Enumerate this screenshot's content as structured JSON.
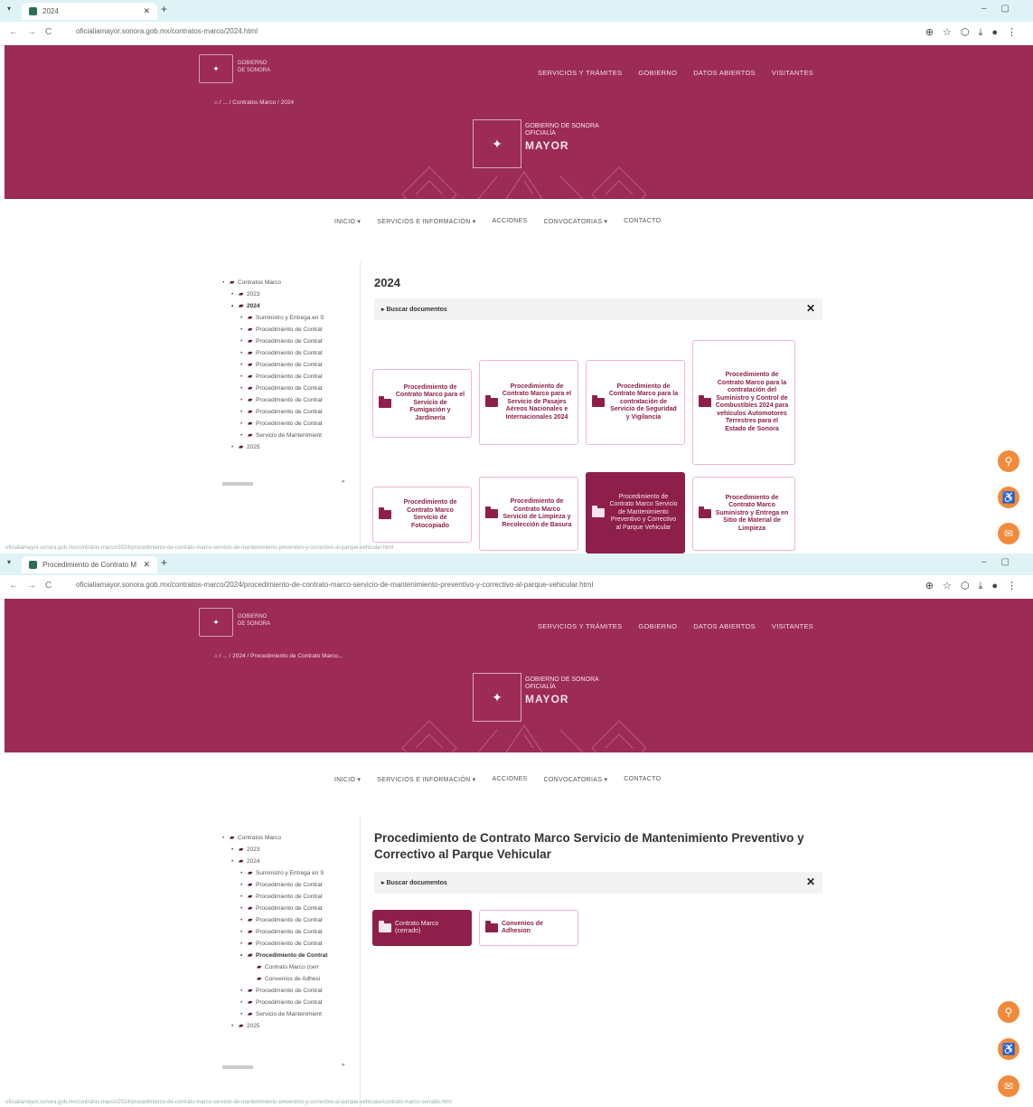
{
  "shot1": {
    "tab_title": "2024",
    "url": "oficialiamayor.sonora.gob.mx/contratos-marco/2024.html",
    "breadcrumb": "⌂ / ... / Contratos Marco / 2024",
    "title": "2024",
    "status_url": "oficialiamayor.sonora.gob.mx/contratos-marco/2024/procedimiento-de-contrato-marco-servicio-de-mantenimiento-preventivo-y-correctivo-al-parque-vehicular.html",
    "cards": [
      "Procedimiento de Contrato Marco para el Servicio de Fumigación y Jardinería",
      "Procedimiento de Contrato Marco para el Servicio de Pasajes Aéreos Nacionales e Internacionales 2024",
      "Procedimiento de Contrato Marco para la contratación de Servicio de Seguridad y Vigilancia",
      "Procedimiento de Contrato Marco para la contratación del Suministro y Control de Combustibles 2024 para vehículos Automotores Terrestres para el Estado de Sonora",
      "Procedimiento de Contrato Marco Servicio de Fotocopiado",
      "Procedimiento de Contrato Marco Servicio de Limpieza y Recolección de Basura",
      "Procedimiento de Contrato Marco Servicio de Mantenimiento Preventivo y Correctivo al Parque Vehicular",
      "Procedimiento de Contrato Marco Suministro y Entrega en Sitio de Material de Limpieza"
    ],
    "tree": [
      {
        "label": "Contratos Marco",
        "level": 0
      },
      {
        "label": "2023",
        "level": 1
      },
      {
        "label": "2024",
        "level": 1,
        "bold": true
      },
      {
        "label": "Suministro y Entrega en S",
        "level": 2
      },
      {
        "label": "Procedimiento de Contrat",
        "level": 2
      },
      {
        "label": "Procedimiento de Contrat",
        "level": 2
      },
      {
        "label": "Procedimiento de Contrat",
        "level": 2
      },
      {
        "label": "Procedimiento de Contrat",
        "level": 2
      },
      {
        "label": "Procedimiento de Contrat",
        "level": 2
      },
      {
        "label": "Procedimiento de Contrat",
        "level": 2
      },
      {
        "label": "Procedimiento de Contrat",
        "level": 2
      },
      {
        "label": "Procedimiento de Contrat",
        "level": 2
      },
      {
        "label": "Procedimiento de Contrat",
        "level": 2
      },
      {
        "label": "Servicio de Mantenimient",
        "level": 2
      },
      {
        "label": "2025",
        "level": 1
      }
    ]
  },
  "shot2": {
    "tab_title": "Procedimiento de Contrato M",
    "url": "oficialiamayor.sonora.gob.mx/contratos-marco/2024/procedimiento-de-contrato-marco-servicio-de-mantenimiento-preventivo-y-correctivo-al-parque-vehicular.html",
    "breadcrumb": "⌂ / ... / 2024 / Procedimiento de Contrato Marco...",
    "title": "Procedimiento de Contrato Marco Servicio de Mantenimiento Preventivo y Correctivo al Parque Vehicular",
    "cards": [
      "Contrato Marco (cerrado)",
      "Convenios de Adhesion"
    ],
    "status_url": "oficialiamayor.sonora.gob.mx/contratos-marco/2024/procedimiento-de-contrato-marco-servicio-de-mantenimiento-preventivo-y-correctivo-al-parque-vehicular/contrato-marco-cerrado.html",
    "tree": [
      {
        "label": "Contratos Marco",
        "level": 0
      },
      {
        "label": "2023",
        "level": 1
      },
      {
        "label": "2024",
        "level": 1
      },
      {
        "label": "Suministro y Entrega en S",
        "level": 2
      },
      {
        "label": "Procedimiento de Contrat",
        "level": 2
      },
      {
        "label": "Procedimiento de Contrat",
        "level": 2
      },
      {
        "label": "Procedimiento de Contrat",
        "level": 2
      },
      {
        "label": "Procedimiento de Contrat",
        "level": 2
      },
      {
        "label": "Procedimiento de Contrat",
        "level": 2
      },
      {
        "label": "Procedimiento de Contrat",
        "level": 2
      },
      {
        "label": "Procedimiento de Contrat",
        "level": 2,
        "bold": true
      },
      {
        "label": "Contrato Marco (cerr",
        "level": 3
      },
      {
        "label": "Convenios de Adhesi",
        "level": 3
      },
      {
        "label": "Procedimiento de Contrat",
        "level": 2
      },
      {
        "label": "Procedimiento de Contrat",
        "level": 2
      },
      {
        "label": "Servicio de Mantenimient",
        "level": 2
      },
      {
        "label": "2025",
        "level": 1
      }
    ]
  },
  "common": {
    "logo_small_text": "GOBIERNO\nDE SONORA",
    "topnav": [
      "SERVICIOS Y TRÁMITES",
      "GOBIERNO",
      "DATOS ABIERTOS",
      "VISITANTES"
    ],
    "logo_center_sub": "GOBIERNO DE SONORA",
    "logo_center_sub2": "OFICIALÍA",
    "logo_center_main": "MAYOR",
    "mainmenu": [
      "INICIO ▾",
      "SERVICIOS E INFORMACIÓN ▾",
      "ACCIONES",
      "CONVOCATORIAS ▾",
      "CONTACTO"
    ],
    "search_label": "▸ Buscar documentos",
    "close_symbol": "✕",
    "accent": "#9c2b55",
    "card_accent": "#8e1f4b",
    "fab_color": "#f28a3c"
  }
}
